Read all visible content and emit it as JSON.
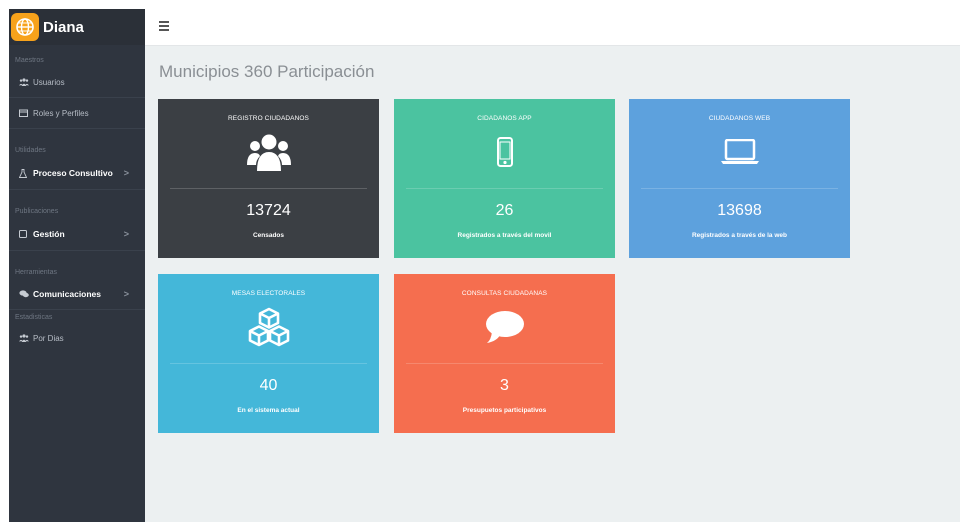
{
  "app": {
    "name": "Diana"
  },
  "sidebar": {
    "sections": [
      {
        "title": "Maestros",
        "items": [
          {
            "label": "Usuarios",
            "icon": "users-icon"
          },
          {
            "label": "Roles y Perfiles",
            "icon": "calendar-icon"
          }
        ]
      },
      {
        "title": "Utilidades",
        "items": [
          {
            "label": "Proceso Consultivo",
            "icon": "flask-icon",
            "chevron": ">"
          }
        ]
      },
      {
        "title": "Publicaciones",
        "items": [
          {
            "label": "Gestión",
            "icon": "square-icon",
            "chevron": ">"
          }
        ]
      },
      {
        "title": "Herramientas",
        "items": [
          {
            "label": "Comunicaciones",
            "icon": "comments-icon",
            "chevron": ">"
          }
        ]
      },
      {
        "title": "Estadisticas",
        "items": [
          {
            "label": "Por Dias",
            "icon": "users-icon"
          }
        ]
      }
    ]
  },
  "page": {
    "title": "Municipios 360 Participación"
  },
  "cards": [
    {
      "title": "REGISTRO CIUDADANOS",
      "value": "13724",
      "label": "Censados",
      "color": "#3b3f44",
      "icon": "users-icon"
    },
    {
      "title": "CIDADANOS APP",
      "value": "26",
      "label": "Registrados a través del movil",
      "color": "#4bc3a0",
      "icon": "mobile-icon"
    },
    {
      "title": "CIUDADANOS WEB",
      "value": "13698",
      "label": "Registrados a través de la web",
      "color": "#5da1dd",
      "icon": "laptop-icon"
    },
    {
      "title": "MESAS ELECTORALES",
      "value": "40",
      "label": "En el sistema actual",
      "color": "#44b7d9",
      "icon": "cubes-icon"
    },
    {
      "title": "CONSULTAS CIUDADANAS",
      "value": "3",
      "label": "Presupuetos participativos",
      "color": "#f56e4f",
      "icon": "comment-icon"
    }
  ]
}
